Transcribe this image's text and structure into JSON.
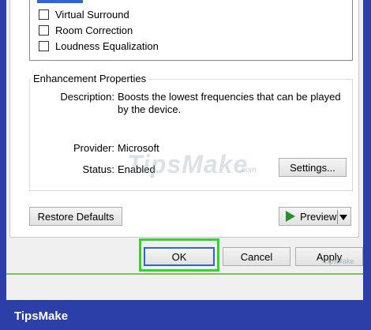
{
  "effects": {
    "items": [
      {
        "label": "Virtual Surround",
        "checked": false
      },
      {
        "label": "Room Correction",
        "checked": false
      },
      {
        "label": "Loudness Equalization",
        "checked": false
      }
    ]
  },
  "enhancement": {
    "title": "Enhancement Properties",
    "description_label": "Description:",
    "description_line1": "Boosts the lowest frequencies that can be played",
    "description_line2": "by the device.",
    "provider_label": "Provider:",
    "provider_value": "Microsoft",
    "status_label": "Status:",
    "status_value": "Enabled",
    "settings_button": "Settings..."
  },
  "actions": {
    "restore_defaults": "Restore Defaults",
    "preview": "Preview"
  },
  "dialog_buttons": {
    "ok": "OK",
    "cancel": "Cancel",
    "apply": "Apply"
  },
  "watermark": {
    "text": "TipsMake",
    "suffix": ".com",
    "apply_overlay": "TipsMake"
  },
  "footer": {
    "brand": "TipsMake"
  },
  "colors": {
    "highlight": "#2ed62e",
    "footer_bg": "#2c3ea8",
    "preview_arrow": "#2e8b2e"
  }
}
